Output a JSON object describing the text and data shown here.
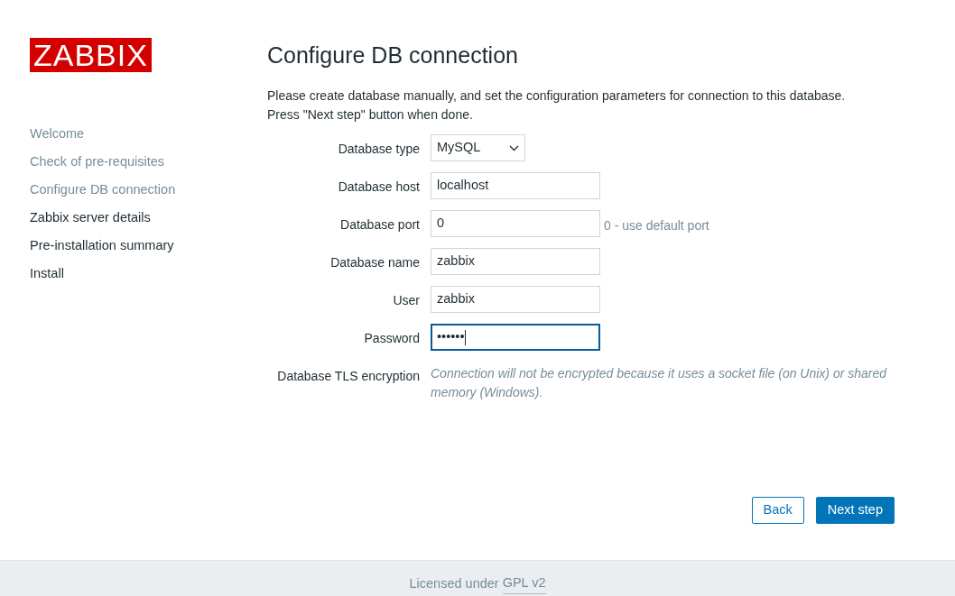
{
  "logo": {
    "text": "ZABBIX"
  },
  "steps": [
    {
      "label": "Welcome",
      "completed": true
    },
    {
      "label": "Check of pre-requisites",
      "completed": true
    },
    {
      "label": "Configure DB connection",
      "completed": true
    },
    {
      "label": "Zabbix server details",
      "completed": false
    },
    {
      "label": "Pre-installation summary",
      "completed": false
    },
    {
      "label": "Install",
      "completed": false
    }
  ],
  "title": "Configure DB connection",
  "intro": [
    "Please create database manually, and set the configuration parameters for connection to this database.",
    "Press \"Next step\" button when done."
  ],
  "fields": [
    {
      "label": "Database type",
      "kind": "select",
      "value": "MySQL"
    },
    {
      "label": "Database host",
      "kind": "text",
      "value": "localhost",
      "focused": false
    },
    {
      "label": "Database port",
      "kind": "text",
      "value": "0",
      "hint": "0 - use default port",
      "focused": false
    },
    {
      "label": "Database name",
      "kind": "text",
      "value": "zabbix",
      "focused": false
    },
    {
      "label": "User",
      "kind": "text",
      "value": "zabbix",
      "focused": false
    },
    {
      "label": "Password",
      "kind": "text",
      "value": "••••••",
      "focused": true
    },
    {
      "label": "Database TLS encryption",
      "kind": "note",
      "value": "Connection will not be encrypted because it uses a socket file (on Unix) or shared memory (Windows)."
    }
  ],
  "buttons": [
    {
      "label": "Back",
      "kind": "secondary"
    },
    {
      "label": "Next step",
      "kind": "primary"
    }
  ],
  "footer": {
    "text": "Licensed under",
    "link": "GPL v2"
  }
}
